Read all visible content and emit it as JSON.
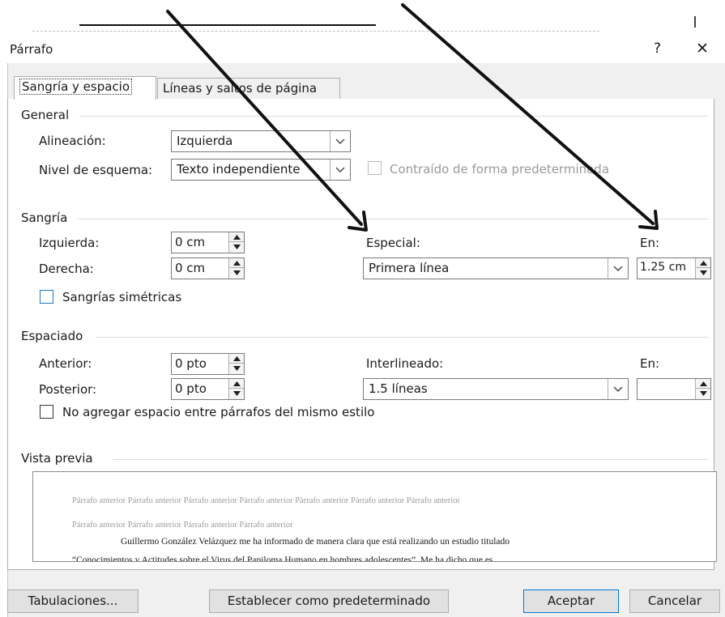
{
  "dialog": {
    "title": "Párrafo",
    "help_glyph": "?",
    "close_glyph": "✕"
  },
  "tabs": [
    {
      "label": "Sangría y espacio",
      "active": true
    },
    {
      "label": "Líneas y saltos de página",
      "active": false
    }
  ],
  "general": {
    "title": "General",
    "alineacion_label": "Alineación:",
    "alineacion_value": "Izquierda",
    "nivel_label": "Nivel de esquema:",
    "nivel_value": "Texto independiente",
    "contraido_label": "Contraído de forma predeterminada",
    "contraido_checked": false
  },
  "sangria": {
    "title": "Sangría",
    "izquierda_label": "Izquierda:",
    "izquierda_value": "0 cm",
    "derecha_label": "Derecha:",
    "derecha_value": "0 cm",
    "especial_label": "Especial:",
    "especial_value": "Primera línea",
    "en_label": "En:",
    "en_value": "1.25 cm",
    "simetricas_label": "Sangrías simétricas",
    "simetricas_checked": false
  },
  "espaciado": {
    "title": "Espaciado",
    "anterior_label": "Anterior:",
    "anterior_value": "0 pto",
    "posterior_label": "Posterior:",
    "posterior_value": "0 pto",
    "interlineado_label": "Interlineado:",
    "interlineado_value": "1.5 líneas",
    "en_label": "En:",
    "en_value": "",
    "no_agregar_label": "No agregar espacio entre párrafos del mismo estilo",
    "no_agregar_checked": false
  },
  "vista_previa": {
    "title": "Vista previa",
    "line1": "Párrafo anterior Párrafo anterior Párrafo anterior Párrafo anterior Párrafo anterior Párrafo anterior Párrafo anterior",
    "line2": "Párrafo anterior Párrafo anterior Párrafo anterior Párrafo anterior",
    "line3": "Guillermo González Velázquez me ha informado de manera clara que está realizando un estudio titulado",
    "line4": "“Conocimientos y Actitudes sobre el Virus del Papiloma Humano en hombres adolescentes”. Me ha dicho que es"
  },
  "buttons": {
    "tabulaciones": "Tabulaciones...",
    "establecer": "Establecer como predeterminado",
    "aceptar": "Aceptar",
    "cancelar": "Cancelar"
  },
  "colors": {
    "accent": "#0078d7",
    "checkbox_focus": "#1e78c8",
    "arrow": "#111111"
  }
}
